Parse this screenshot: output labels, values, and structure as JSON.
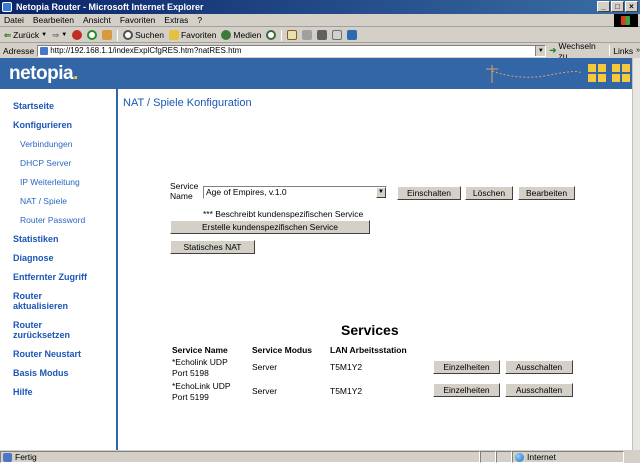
{
  "window": {
    "title": "Netopia Router - Microsoft Internet Explorer"
  },
  "menu": [
    "Datei",
    "Bearbeiten",
    "Ansicht",
    "Favoriten",
    "Extras",
    "?"
  ],
  "toolbar": {
    "back": "Zurück",
    "search": "Suchen",
    "favorites": "Favoriten",
    "media": "Medien"
  },
  "address": {
    "label": "Adresse",
    "url": "http://192.168.1.1/indexExplCfgRES.htm?natRES.htm",
    "go": "Wechseln zu",
    "links": "Links"
  },
  "brand": {
    "logo": "netopia",
    "logo_dot": "."
  },
  "sidebar": {
    "items": [
      {
        "label": "Startseite",
        "level": 1
      },
      {
        "label": "Konfigurieren",
        "level": 1
      },
      {
        "label": "Verbindungen",
        "level": 2
      },
      {
        "label": "DHCP Server",
        "level": 2
      },
      {
        "label": "IP Weiterleitung",
        "level": 2
      },
      {
        "label": "NAT / Spiele",
        "level": 2
      },
      {
        "label": "Router Password",
        "level": 2
      },
      {
        "label": "Statistiken",
        "level": 1
      },
      {
        "label": "Diagnose",
        "level": 1
      },
      {
        "label": "Entfernter Zugriff",
        "level": 1
      },
      {
        "label": "Router aktualisieren",
        "level": 1
      },
      {
        "label": "Router zurücksetzen",
        "level": 1
      },
      {
        "label": "Router Neustart",
        "level": 1
      },
      {
        "label": "Basis Modus",
        "level": 1
      },
      {
        "label": "Hilfe",
        "level": 1
      }
    ]
  },
  "main": {
    "title": "NAT / Spiele Konfiguration",
    "service_label_1": "Service",
    "service_label_2": "Name",
    "service_select": "Age of Empires, v.1.0",
    "buttons": {
      "enable": "Einschalten",
      "delete": "Löschen",
      "edit": "Bearbeiten",
      "create_custom": "Erstelle kundenspezifischen Service",
      "static_nat": "Statisches NAT"
    },
    "custom_note": "*** Beschreibt kundenspezifischen Service",
    "services": {
      "heading": "Services",
      "columns": [
        "Service Name",
        "Service Modus",
        "LAN Arbeitsstation"
      ],
      "rows": [
        {
          "name_1": "*Echolink UDP",
          "name_2": "Port 5198",
          "mode": "Server",
          "station": "T5M1Y2",
          "details": "Einzelheiten",
          "disable": "Ausschalten"
        },
        {
          "name_1": "*EchoLink UDP",
          "name_2": "Port 5199",
          "mode": "Server",
          "station": "T5M1Y2",
          "details": "Einzelheiten",
          "disable": "Ausschalten"
        }
      ]
    }
  },
  "status": {
    "text": "Fertig",
    "zone": "Internet"
  },
  "colors": {
    "brand_blue": "#3366a6",
    "nav_blue": "#1a56b5",
    "accent_yellow": "#f7c83a"
  }
}
